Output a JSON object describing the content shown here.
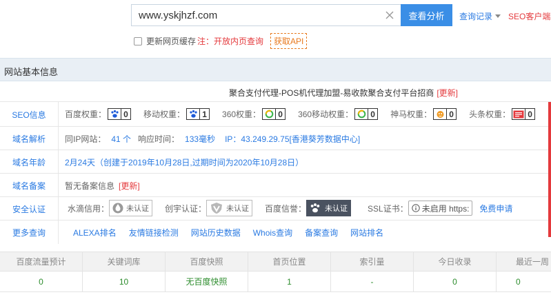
{
  "search": {
    "value": "www.yskjhzf.com",
    "button_label": "查看分析",
    "history_label": "查询记录",
    "seo_client_label": "SEO客户端下"
  },
  "options": {
    "cache_label": "更新网页缓存",
    "note_label": "注：开放内页查询",
    "api_label": "获取API"
  },
  "section_title": "网站基本信息",
  "site_title": {
    "title": "聚合支付代理-POS机代理加盟-易收款聚合支付平台招商",
    "update_label": "[更新]"
  },
  "seo": {
    "label": "SEO信息",
    "weights": [
      {
        "name": "百度权重：",
        "value": "0",
        "icon": "paw-icon"
      },
      {
        "name": "移动权重：",
        "value": "1",
        "icon": "paw-icon"
      },
      {
        "name": "360权重：",
        "value": "0",
        "icon": "360-icon"
      },
      {
        "name": "360移动权重：",
        "value": "0",
        "icon": "360-icon"
      },
      {
        "name": "神马权重：",
        "value": "0",
        "icon": "shenma-icon"
      },
      {
        "name": "头条权重：",
        "value": "0",
        "icon": "toutiao-icon"
      }
    ]
  },
  "dns": {
    "label": "域名解析",
    "same_ip_label": "同IP网站：",
    "same_ip_value": "41 个",
    "response_label": "响应时间：",
    "response_value": "133毫秒",
    "ip_label": "IP：",
    "ip_value": "43.249.29.75",
    "ip_location": "[香港葵芳数据中心]"
  },
  "age": {
    "label": "域名年龄",
    "value": "2月24天（创建于2019年10月28日,过期时间为2020年10月28日）"
  },
  "icp": {
    "label": "域名备案",
    "value": "暂无备案信息",
    "update_label": "[更新]"
  },
  "security": {
    "label": "安全认证",
    "water_label": "水滴信用：",
    "water_status": "未认证",
    "chuangyu_label": "创宇认证：",
    "chuangyu_status": "未认证",
    "baidu_label": "百度信誉：",
    "baidu_status": "未认证",
    "ssl_label": "SSL证书：",
    "ssl_status": "未启用 https:",
    "apply_label": "免费申请"
  },
  "more": {
    "label": "更多查询",
    "links": [
      "ALEXA排名",
      "友情链接检测",
      "网站历史数据",
      "Whois查询",
      "备案查询",
      "网站排名"
    ]
  },
  "stats": {
    "headers": [
      "百度流量预计",
      "关键词库",
      "百度快照",
      "首页位置",
      "索引量",
      "今日收录",
      "最近一周"
    ],
    "values": [
      "0",
      "10",
      "无百度快照",
      "1",
      "-",
      "0",
      "0"
    ]
  },
  "colors": {
    "accent_blue": "#3a8ee6",
    "link_blue": "#2a7ae2",
    "warning_red": "#e4393c",
    "value_green": "#2c8c2c"
  }
}
